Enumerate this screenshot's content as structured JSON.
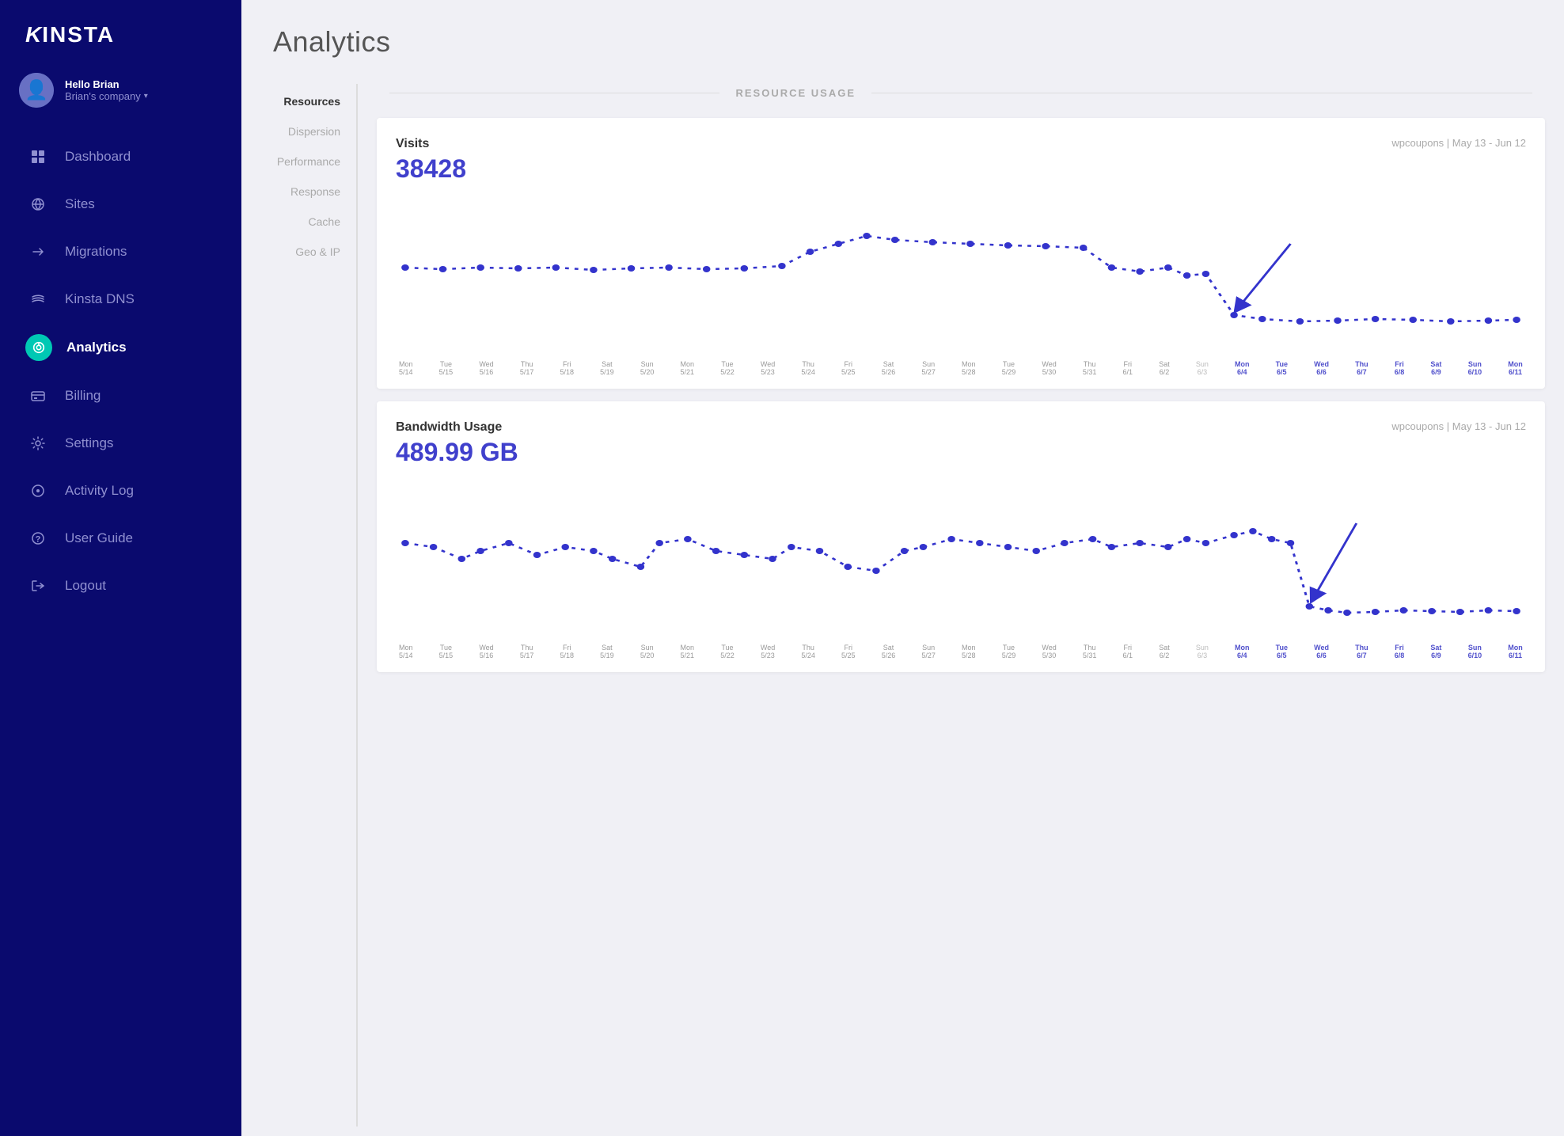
{
  "sidebar": {
    "logo": "kinsta",
    "user": {
      "greeting": "Hello Brian",
      "company": "Brian's company"
    },
    "nav_items": [
      {
        "id": "dashboard",
        "label": "Dashboard",
        "icon": "⌂"
      },
      {
        "id": "sites",
        "label": "Sites",
        "icon": "◈"
      },
      {
        "id": "migrations",
        "label": "Migrations",
        "icon": "→"
      },
      {
        "id": "kinsta-dns",
        "label": "Kinsta DNS",
        "icon": "⁓"
      },
      {
        "id": "analytics",
        "label": "Analytics",
        "icon": "◎",
        "active": true
      },
      {
        "id": "billing",
        "label": "Billing",
        "icon": "▬"
      },
      {
        "id": "settings",
        "label": "Settings",
        "icon": "⚙"
      },
      {
        "id": "activity-log",
        "label": "Activity Log",
        "icon": "👁"
      },
      {
        "id": "user-guide",
        "label": "User Guide",
        "icon": "?"
      },
      {
        "id": "logout",
        "label": "Logout",
        "icon": "↩"
      }
    ]
  },
  "page": {
    "title": "Analytics"
  },
  "sub_nav": {
    "items": [
      {
        "id": "resources",
        "label": "Resources",
        "active": true
      },
      {
        "id": "dispersion",
        "label": "Dispersion"
      },
      {
        "id": "performance",
        "label": "Performance"
      },
      {
        "id": "response",
        "label": "Response"
      },
      {
        "id": "cache",
        "label": "Cache"
      },
      {
        "id": "geo-ip",
        "label": "Geo & IP"
      }
    ]
  },
  "resource_header": {
    "title": "RESOURCE USAGE"
  },
  "visits_chart": {
    "label": "Visits",
    "value": "38428",
    "meta": "wpcoupons | May 13 - Jun 12",
    "x_labels": [
      {
        "day": "Mon",
        "date": "5/14"
      },
      {
        "day": "Tue",
        "date": "5/15"
      },
      {
        "day": "Wed",
        "date": "5/16"
      },
      {
        "day": "Thu",
        "date": "5/17"
      },
      {
        "day": "Fri",
        "date": "5/18"
      },
      {
        "day": "Sat",
        "date": "5/19"
      },
      {
        "day": "Sun",
        "date": "5/20"
      },
      {
        "day": "Mon",
        "date": "5/21"
      },
      {
        "day": "Tue",
        "date": "5/22"
      },
      {
        "day": "Wed",
        "date": "5/23"
      },
      {
        "day": "Thu",
        "date": "5/24"
      },
      {
        "day": "Fri",
        "date": "5/25"
      },
      {
        "day": "Sat",
        "date": "5/26"
      },
      {
        "day": "Sun",
        "date": "5/27"
      },
      {
        "day": "Mon",
        "date": "5/28"
      },
      {
        "day": "Tue",
        "date": "5/29"
      },
      {
        "day": "Wed",
        "date": "5/30"
      },
      {
        "day": "Thu",
        "date": "5/31"
      },
      {
        "day": "Fri",
        "date": "6/1"
      },
      {
        "day": "Sat",
        "date": "6/2"
      },
      {
        "day": "Sun",
        "date": "6/3"
      },
      {
        "day": "Mon",
        "date": "6/4"
      },
      {
        "day": "Tue",
        "date": "6/5"
      },
      {
        "day": "Wed",
        "date": "6/6"
      },
      {
        "day": "Thu",
        "date": "6/7"
      },
      {
        "day": "Fri",
        "date": "6/8"
      },
      {
        "day": "Sat",
        "date": "6/9"
      },
      {
        "day": "Sun",
        "date": "6/10"
      },
      {
        "day": "Mon",
        "date": "6/11"
      }
    ]
  },
  "bandwidth_chart": {
    "label": "Bandwidth Usage",
    "value": "489.99 GB",
    "meta": "wpcoupons | May 13 - Jun 12",
    "x_labels": [
      {
        "day": "Mon",
        "date": "5/14"
      },
      {
        "day": "Tue",
        "date": "5/15"
      },
      {
        "day": "Wed",
        "date": "5/16"
      },
      {
        "day": "Thu",
        "date": "5/17"
      },
      {
        "day": "Fri",
        "date": "5/18"
      },
      {
        "day": "Sat",
        "date": "5/19"
      },
      {
        "day": "Sun",
        "date": "5/20"
      },
      {
        "day": "Mon",
        "date": "5/21"
      },
      {
        "day": "Tue",
        "date": "5/22"
      },
      {
        "day": "Wed",
        "date": "5/23"
      },
      {
        "day": "Thu",
        "date": "5/24"
      },
      {
        "day": "Fri",
        "date": "5/25"
      },
      {
        "day": "Sat",
        "date": "5/26"
      },
      {
        "day": "Sun",
        "date": "5/27"
      },
      {
        "day": "Mon",
        "date": "5/28"
      },
      {
        "day": "Tue",
        "date": "5/29"
      },
      {
        "day": "Wed",
        "date": "5/30"
      },
      {
        "day": "Thu",
        "date": "5/31"
      },
      {
        "day": "Fri",
        "date": "6/1"
      },
      {
        "day": "Sat",
        "date": "6/2"
      },
      {
        "day": "Sun",
        "date": "6/3"
      },
      {
        "day": "Mon",
        "date": "6/4"
      },
      {
        "day": "Tue",
        "date": "6/5"
      },
      {
        "day": "Wed",
        "date": "6/6"
      },
      {
        "day": "Thu",
        "date": "6/7"
      },
      {
        "day": "Fri",
        "date": "6/8"
      },
      {
        "day": "Sat",
        "date": "6/9"
      },
      {
        "day": "Sun",
        "date": "6/10"
      },
      {
        "day": "Mon",
        "date": "6/11"
      }
    ]
  }
}
